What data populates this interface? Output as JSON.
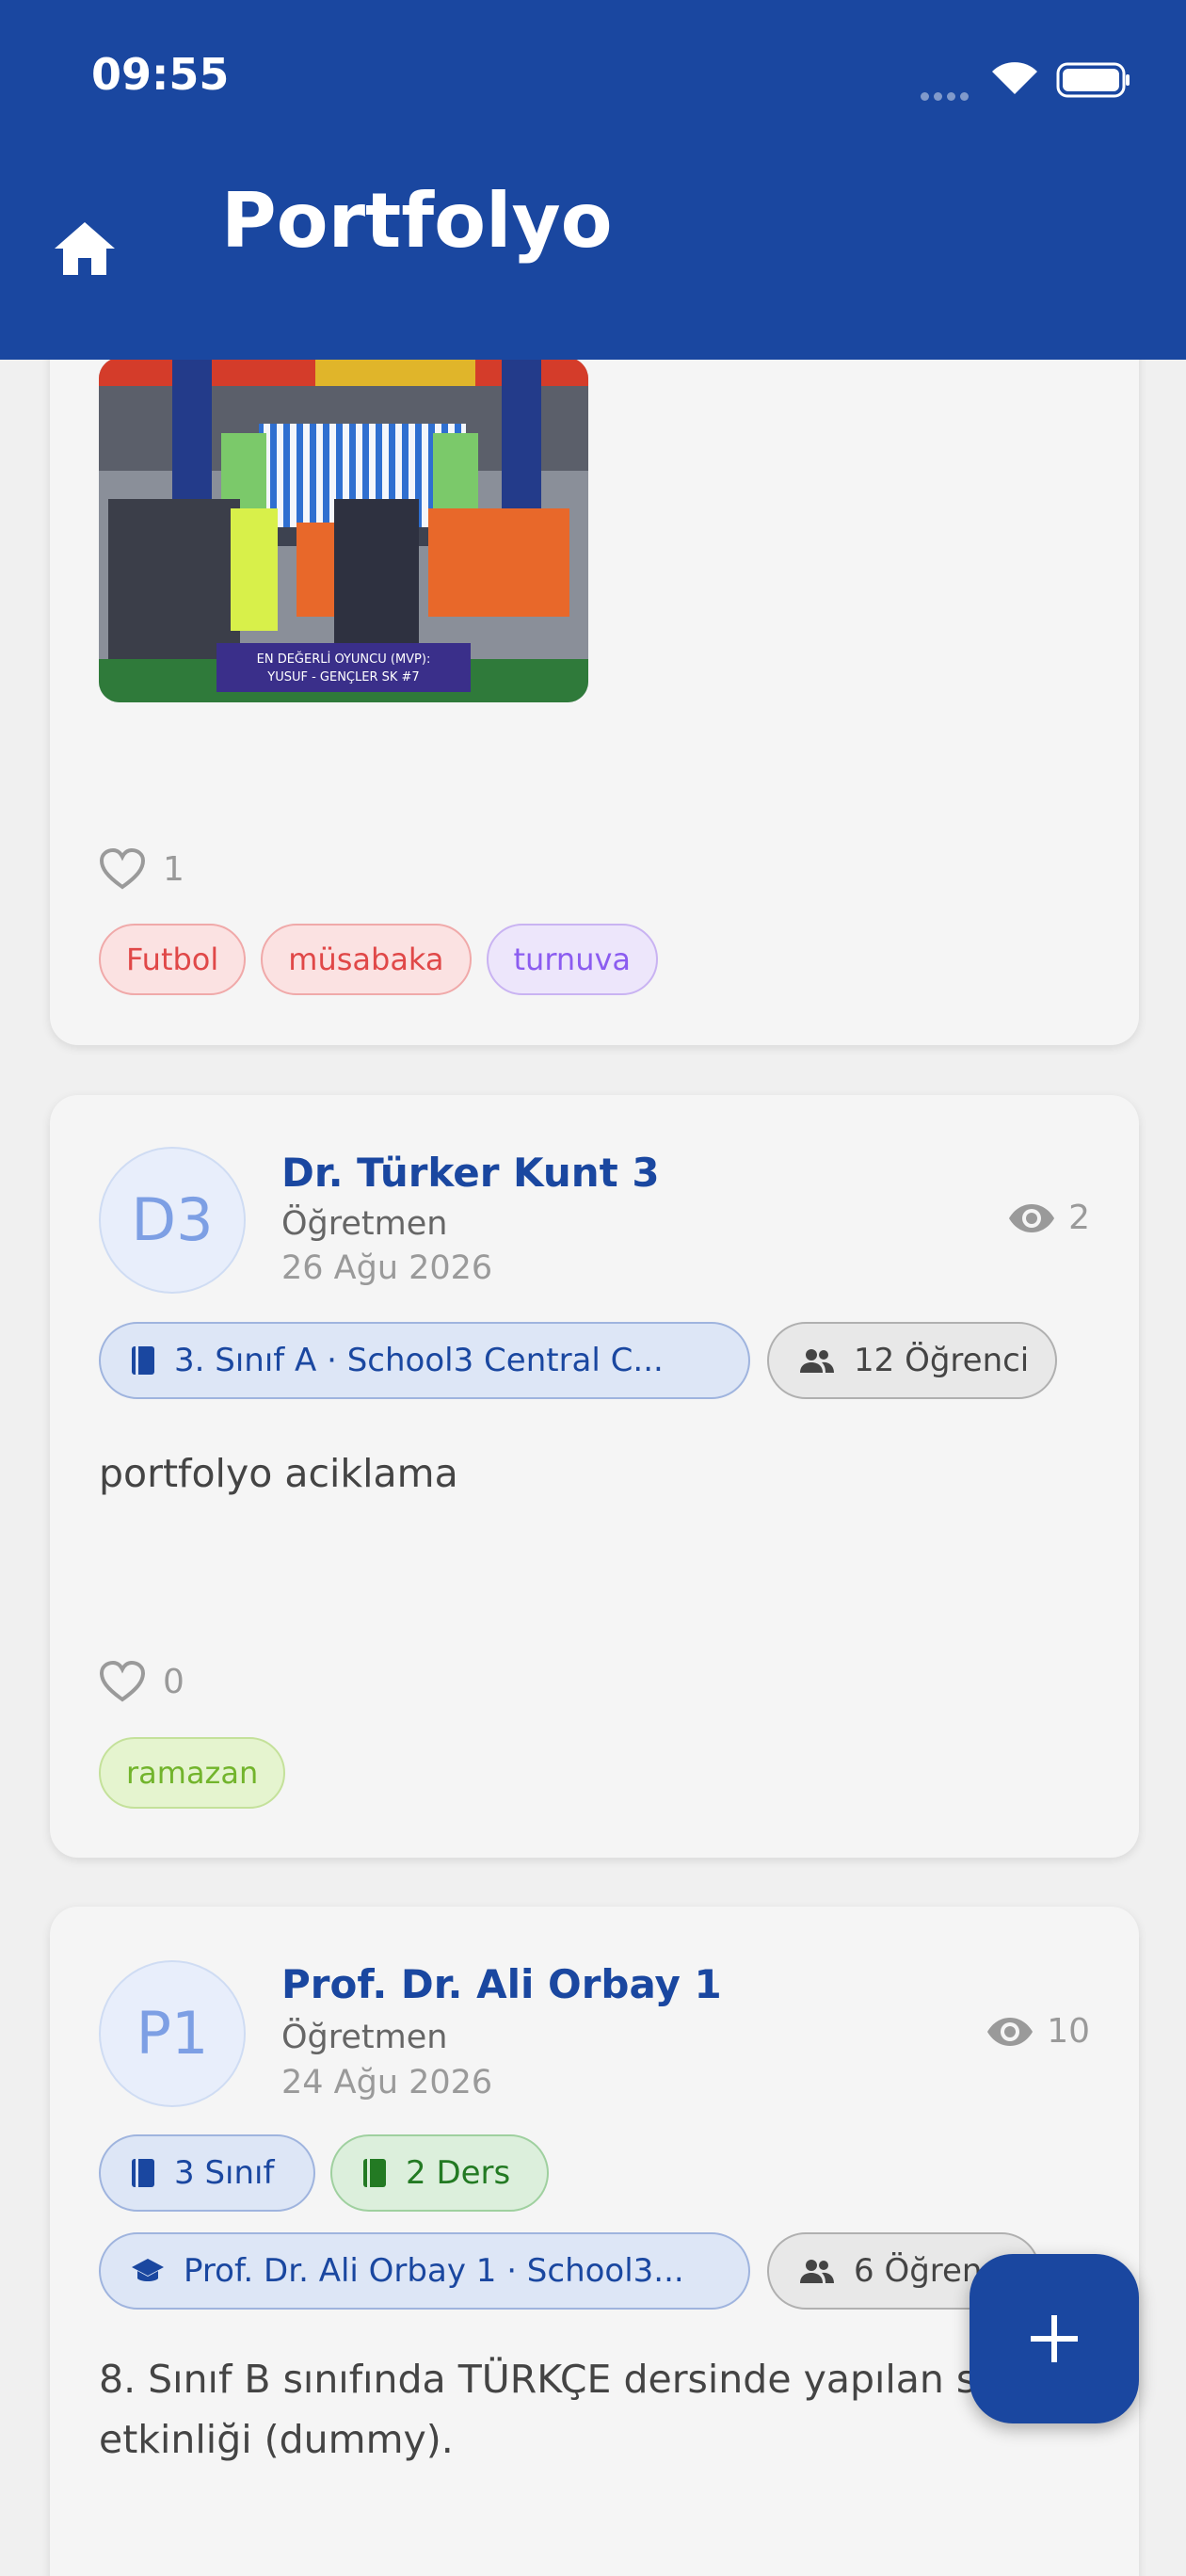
{
  "status_bar": {
    "time": "09:55"
  },
  "header": {
    "title": "Portfolyo"
  },
  "posts": [
    {
      "photo_caption": "EN DEĞERLİ OYUNCU (MVP): YUSUF - GENÇLER SK #7",
      "likes": "1",
      "tags": [
        "Futbol",
        "müsabaka",
        "turnuva"
      ]
    },
    {
      "avatar": "D3",
      "author": "Dr. Türker Kunt 3",
      "role": "Öğretmen",
      "date": "26 Ağu 2026",
      "views": "2",
      "class_chip": "3. Sınıf A · School3 Central C...",
      "students_chip": "12 Öğrenci",
      "description": "portfolyo aciklama",
      "likes": "0",
      "tags": [
        "ramazan"
      ]
    },
    {
      "avatar": "P1",
      "author": "Prof. Dr. Ali Orbay 1",
      "role": "Öğretmen",
      "date": "24 Ağu 2026",
      "views": "10",
      "class_chip": "3 Sınıf",
      "lesson_chip": "2 Ders",
      "school_chip": "Prof. Dr. Ali Orbay 1 · School3...",
      "students_chip": "6 Öğrenci",
      "description": "8. Sınıf B sınıfında TÜRKÇE dersinde yapılan sınıf etkinliği (dummy)."
    }
  ],
  "fab": {
    "icon": "plus-icon"
  },
  "colors": {
    "primary": "#1a47a0",
    "background": "#f0f0f0",
    "card": "#f5f5f5",
    "tag_red": "#e04848",
    "tag_purple": "#8b5cf0",
    "tag_green": "#72b42c"
  }
}
